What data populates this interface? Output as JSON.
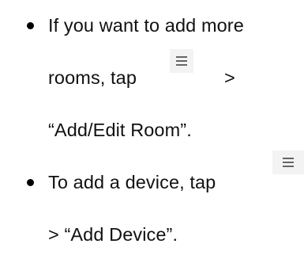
{
  "instructions": {
    "item1": {
      "line1": "If you want to add more",
      "line2_prefix": "rooms, tap",
      "line2_suffix": ">",
      "line3": "“Add/Edit Room”."
    },
    "item2": {
      "line1_prefix": "To add a device, tap",
      "line2": "> “Add Device”."
    },
    "icon": "menu-icon"
  }
}
